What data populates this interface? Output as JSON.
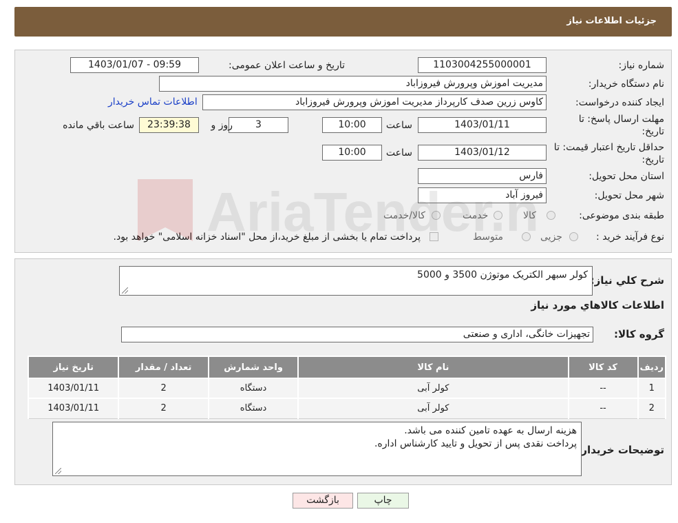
{
  "header": {
    "title": "جزئیات اطلاعات نیاز"
  },
  "form": {
    "need_number_label": "شماره نیاز:",
    "need_number": "1103004255000001",
    "announce_label": "تاریخ و ساعت اعلان عمومی:",
    "announce_value": "1403/01/07 - 09:59",
    "buyer_org_label": "نام دستگاه خریدار:",
    "buyer_org": "مدیریت اموزش وپرورش فیروزاباد",
    "requester_label": "ایجاد کننده درخواست:",
    "requester": "کاوس زرین صدف کارپرداز مدیریت اموزش وپرورش فیروزاباد",
    "contact_link": "اطلاعات تماس خریدار",
    "deadline_label_1": "مهلت ارسال پاسخ: تا",
    "deadline_label_2": "تاریخ:",
    "deadline_date": "1403/01/11",
    "time_label": "ساعت",
    "deadline_time": "10:00",
    "days": "3",
    "days_label": "روز و",
    "remaining_time": "23:39:38",
    "remaining_label": "ساعت باقي مانده",
    "validity_label_1": "حداقل تاریخ اعتبار قیمت: تا",
    "validity_label_2": "تاریخ:",
    "validity_date": "1403/01/12",
    "validity_time": "10:00",
    "province_label": "استان محل تحویل:",
    "province": "فارس",
    "city_label": "شهر محل تحویل:",
    "city": "فیروز آباد",
    "category_label": "طبقه بندی موضوعی:",
    "category_options": [
      "کالا",
      "خدمت",
      "کالا/خدمت"
    ],
    "process_label": "نوع فرآیند خرید :",
    "process_options": [
      "جزیی",
      "متوسط"
    ],
    "payment_note": "پرداخت تمام یا بخشی از مبلغ خرید،از محل \"اسناد خزانه اسلامی\" خواهد بود."
  },
  "description": {
    "label": "شرح کلي نياز:",
    "value": "کولر سبهر الکتریک موتوژن 3500 و 5000"
  },
  "goods_info_title": "اطلاعات کالاهاي مورد نياز",
  "goods_group": {
    "label": "گروه کالا:",
    "value": "تجهیزات خانگی، اداری و صنعتی"
  },
  "table": {
    "headers": [
      "رديف",
      "کد کالا",
      "نام کالا",
      "واحد شمارش",
      "تعداد / مقدار",
      "تاريخ نياز"
    ],
    "rows": [
      [
        "1",
        "--",
        "کولر آبی",
        "دستگاه",
        "2",
        "1403/01/11"
      ],
      [
        "2",
        "--",
        "کولر آبی",
        "دستگاه",
        "2",
        "1403/01/11"
      ]
    ]
  },
  "buyer_notes": {
    "label": "توضیحات خریدار:",
    "line1": "هزینه ارسال به عهده تامین کننده می باشد.",
    "line2": "پرداخت نقدی پس از تحویل و تایید کارشناس اداره."
  },
  "buttons": {
    "print": "چاپ",
    "back": "بازگشت"
  },
  "colors": {
    "header_bg": "#7b5d3c",
    "table_header_bg": "#8c8c8c",
    "link": "#1a3fc7"
  }
}
